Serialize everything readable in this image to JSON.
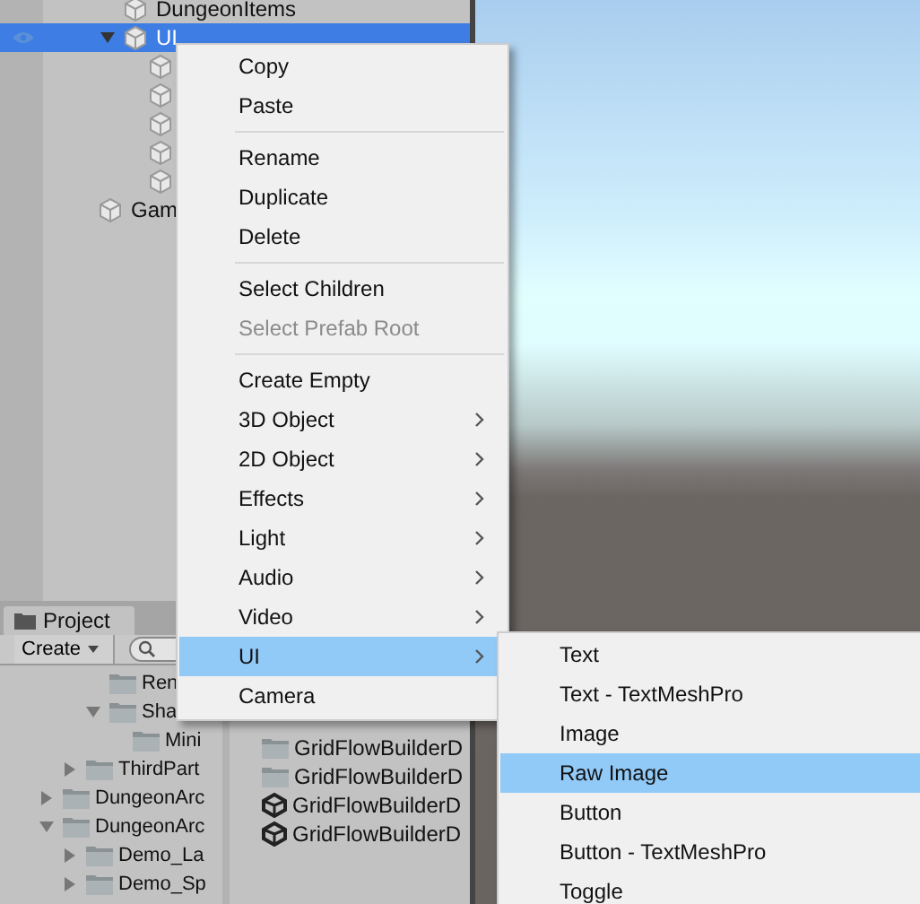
{
  "hierarchy": {
    "items": [
      {
        "children": [
          {
            "label": "DungeonItems",
            "selected": false
          },
          {
            "label": "UI",
            "selected": true,
            "expanded": true,
            "visible_eye": true,
            "children": [
              {
                "selected": false
              },
              {
                "selected": false
              },
              {
                "selected": false
              },
              {
                "selected": false
              },
              {
                "selected": false
              }
            ]
          }
        ]
      },
      {
        "label": "Gam",
        "selected": false
      }
    ]
  },
  "project": {
    "tab": "Project",
    "create": "Create",
    "tree": [
      {
        "children": [
          {
            "children": [
              {
                "label": "Ren"
              },
              {
                "label": "Sha",
                "expanded": true,
                "children": [
                  {
                    "label": "Mini"
                  }
                ]
              }
            ]
          },
          {
            "label": "ThirdPart",
            "expanded": false
          }
        ]
      },
      {
        "label": "DungeonArc",
        "expanded": false
      },
      {
        "label": "DungeonArc",
        "expanded": true,
        "children": [
          {
            "label": "Demo_La",
            "expanded": false
          },
          {
            "label": "Demo_Sp",
            "expanded": false
          }
        ]
      }
    ],
    "files": [
      {
        "label": "GridFlowBuilderD",
        "kind": "folder"
      },
      {
        "label": "GridFlowBuilderD",
        "kind": "folder"
      },
      {
        "label": "GridFlowBuilderD",
        "kind": "scene"
      },
      {
        "label": "GridFlowBuilderD",
        "kind": "scene"
      }
    ]
  },
  "context_menu": {
    "groups": [
      [
        {
          "label": "Copy",
          "submenu": false,
          "disabled": false,
          "selected": false
        },
        {
          "label": "Paste",
          "submenu": false,
          "disabled": false,
          "selected": false
        }
      ],
      [
        {
          "label": "Rename",
          "submenu": false,
          "disabled": false,
          "selected": false
        },
        {
          "label": "Duplicate",
          "submenu": false,
          "disabled": false,
          "selected": false
        },
        {
          "label": "Delete",
          "submenu": false,
          "disabled": false,
          "selected": false
        }
      ],
      [
        {
          "label": "Select Children",
          "submenu": false,
          "disabled": false,
          "selected": false
        },
        {
          "label": "Select Prefab Root",
          "submenu": false,
          "disabled": true,
          "selected": false
        }
      ],
      [
        {
          "label": "Create Empty",
          "submenu": false,
          "disabled": false,
          "selected": false
        },
        {
          "label": "3D Object",
          "submenu": true,
          "disabled": false,
          "selected": false
        },
        {
          "label": "2D Object",
          "submenu": true,
          "disabled": false,
          "selected": false
        },
        {
          "label": "Effects",
          "submenu": true,
          "disabled": false,
          "selected": false
        },
        {
          "label": "Light",
          "submenu": true,
          "disabled": false,
          "selected": false
        },
        {
          "label": "Audio",
          "submenu": true,
          "disabled": false,
          "selected": false
        },
        {
          "label": "Video",
          "submenu": true,
          "disabled": false,
          "selected": false
        },
        {
          "label": "UI",
          "submenu": true,
          "disabled": false,
          "selected": true
        },
        {
          "label": "Camera",
          "submenu": false,
          "disabled": false,
          "selected": false
        }
      ]
    ]
  },
  "submenu": {
    "items": [
      {
        "label": "Text",
        "selected": false
      },
      {
        "label": "Text - TextMeshPro",
        "selected": false
      },
      {
        "label": "Image",
        "selected": false
      },
      {
        "label": "Raw Image",
        "selected": true
      },
      {
        "label": "Button",
        "selected": false
      },
      {
        "label": "Button - TextMeshPro",
        "selected": false
      },
      {
        "label": "Toggle",
        "selected": false
      }
    ]
  }
}
